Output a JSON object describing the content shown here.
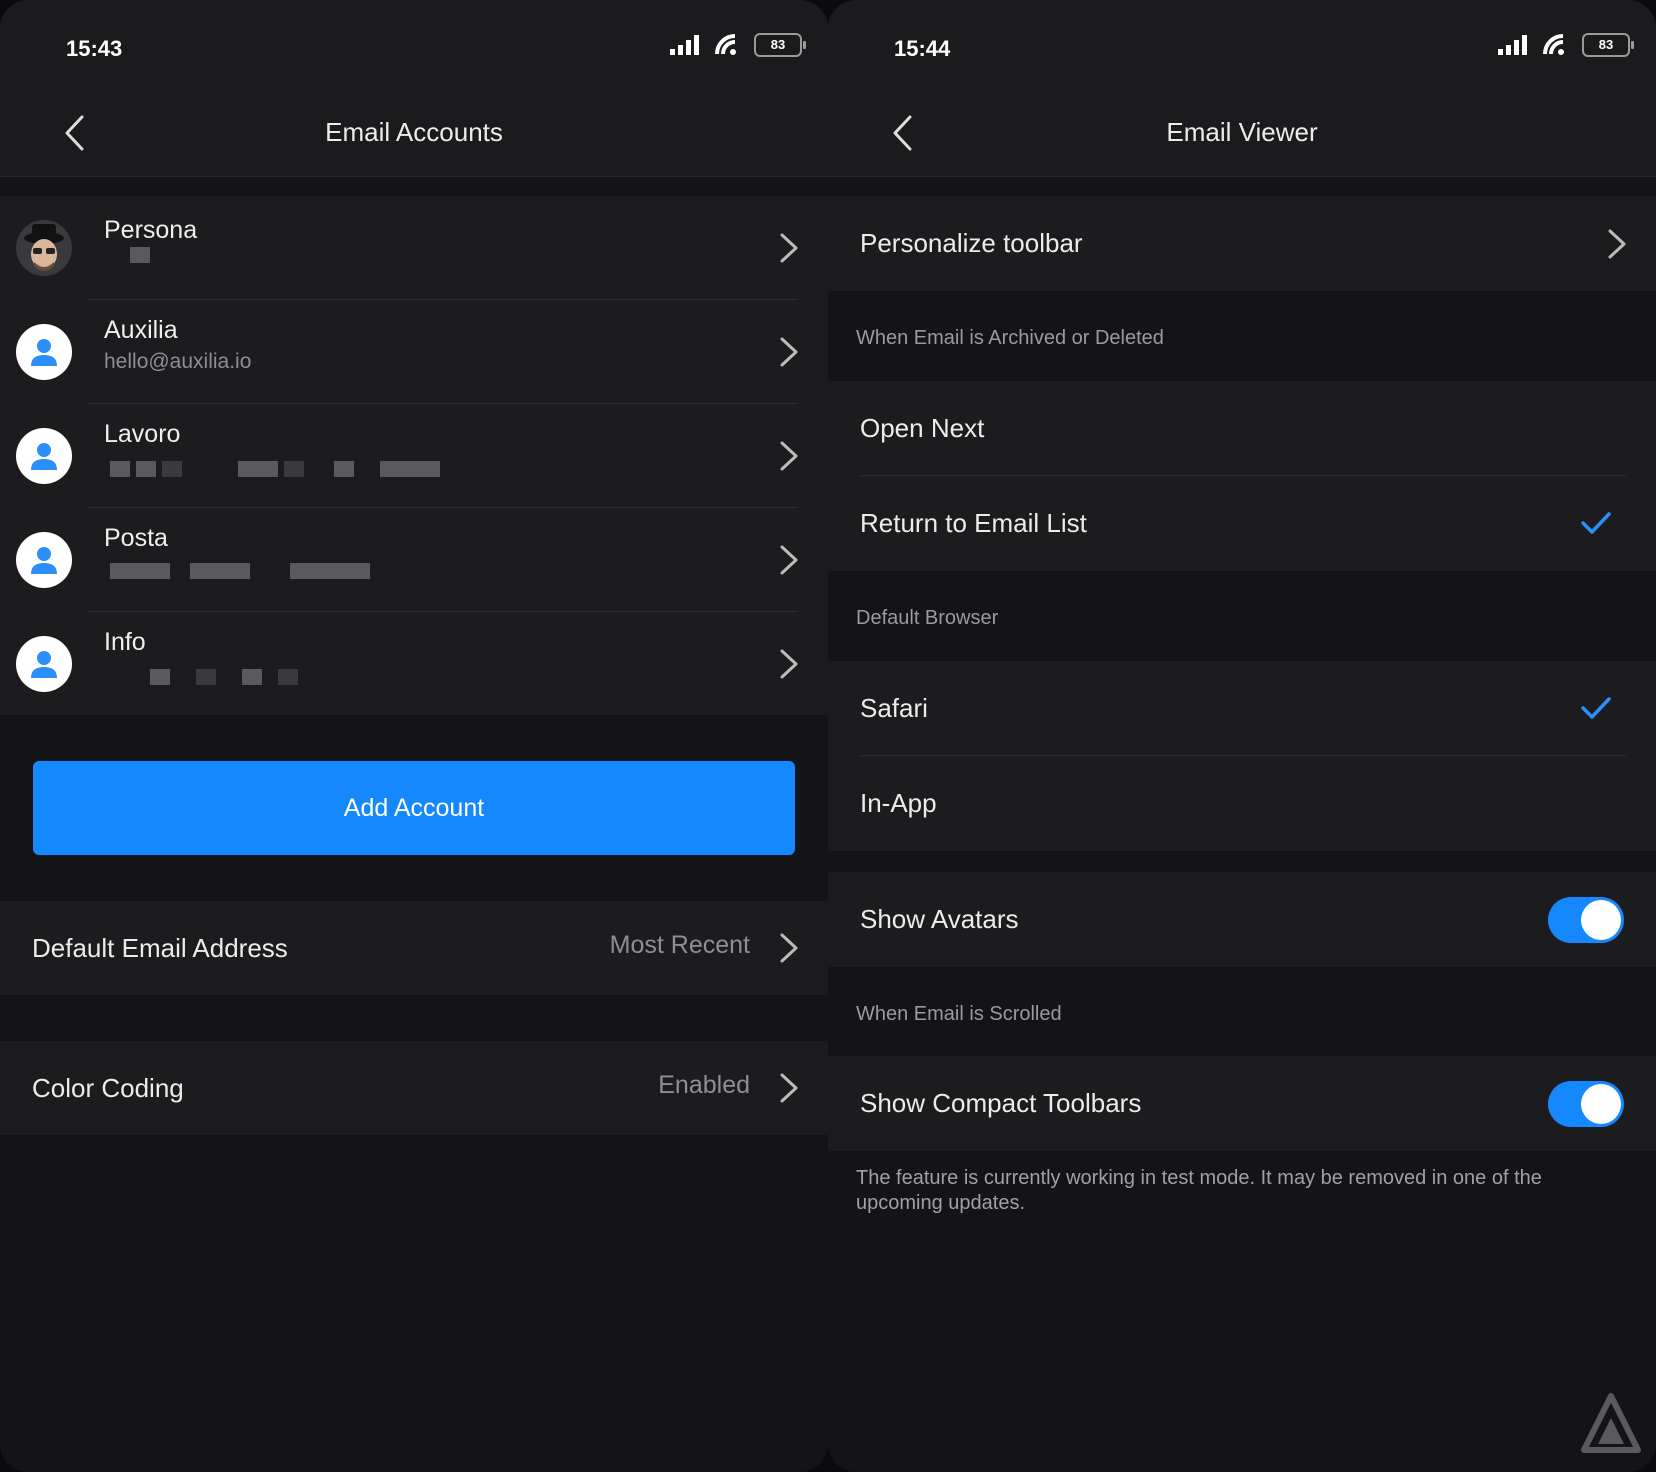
{
  "left": {
    "status": {
      "time": "15:43",
      "battery": "83"
    },
    "nav": {
      "title": "Email Accounts",
      "back_icon": "chevron-left-icon"
    },
    "accounts": [
      {
        "name": "Persona",
        "subtitle": ""
      },
      {
        "name": "Auxilia",
        "subtitle": "hello@auxilia.io"
      },
      {
        "name": "Lavoro",
        "subtitle": ""
      },
      {
        "name": "Posta",
        "subtitle": ""
      },
      {
        "name": "Info",
        "subtitle": ""
      }
    ],
    "add_account_label": "Add Account",
    "default_email": {
      "label": "Default Email Address",
      "value": "Most Recent"
    },
    "color_coding": {
      "label": "Color Coding",
      "value": "Enabled"
    }
  },
  "right": {
    "status": {
      "time": "15:44",
      "battery": "83"
    },
    "nav": {
      "title": "Email Viewer",
      "back_icon": "chevron-left-icon"
    },
    "personalize_toolbar": "Personalize toolbar",
    "archived_header": "When Email is Archived or Deleted",
    "open_next": "Open Next",
    "return_to_list": "Return to Email List",
    "return_to_list_selected": true,
    "browser_header": "Default Browser",
    "safari": "Safari",
    "safari_selected": true,
    "in_app": "In-App",
    "show_avatars": {
      "label": "Show Avatars",
      "enabled": true
    },
    "scrolled_header": "When Email is Scrolled",
    "compact_toolbars": {
      "label": "Show Compact Toolbars",
      "enabled": true
    },
    "footnote": "The feature is currently working in test mode. It may be removed in one of the upcoming updates."
  },
  "colors": {
    "accent": "#1488fc",
    "background": "#141416",
    "cell": "#1c1c1f",
    "secondary_text": "#8e8e93"
  }
}
